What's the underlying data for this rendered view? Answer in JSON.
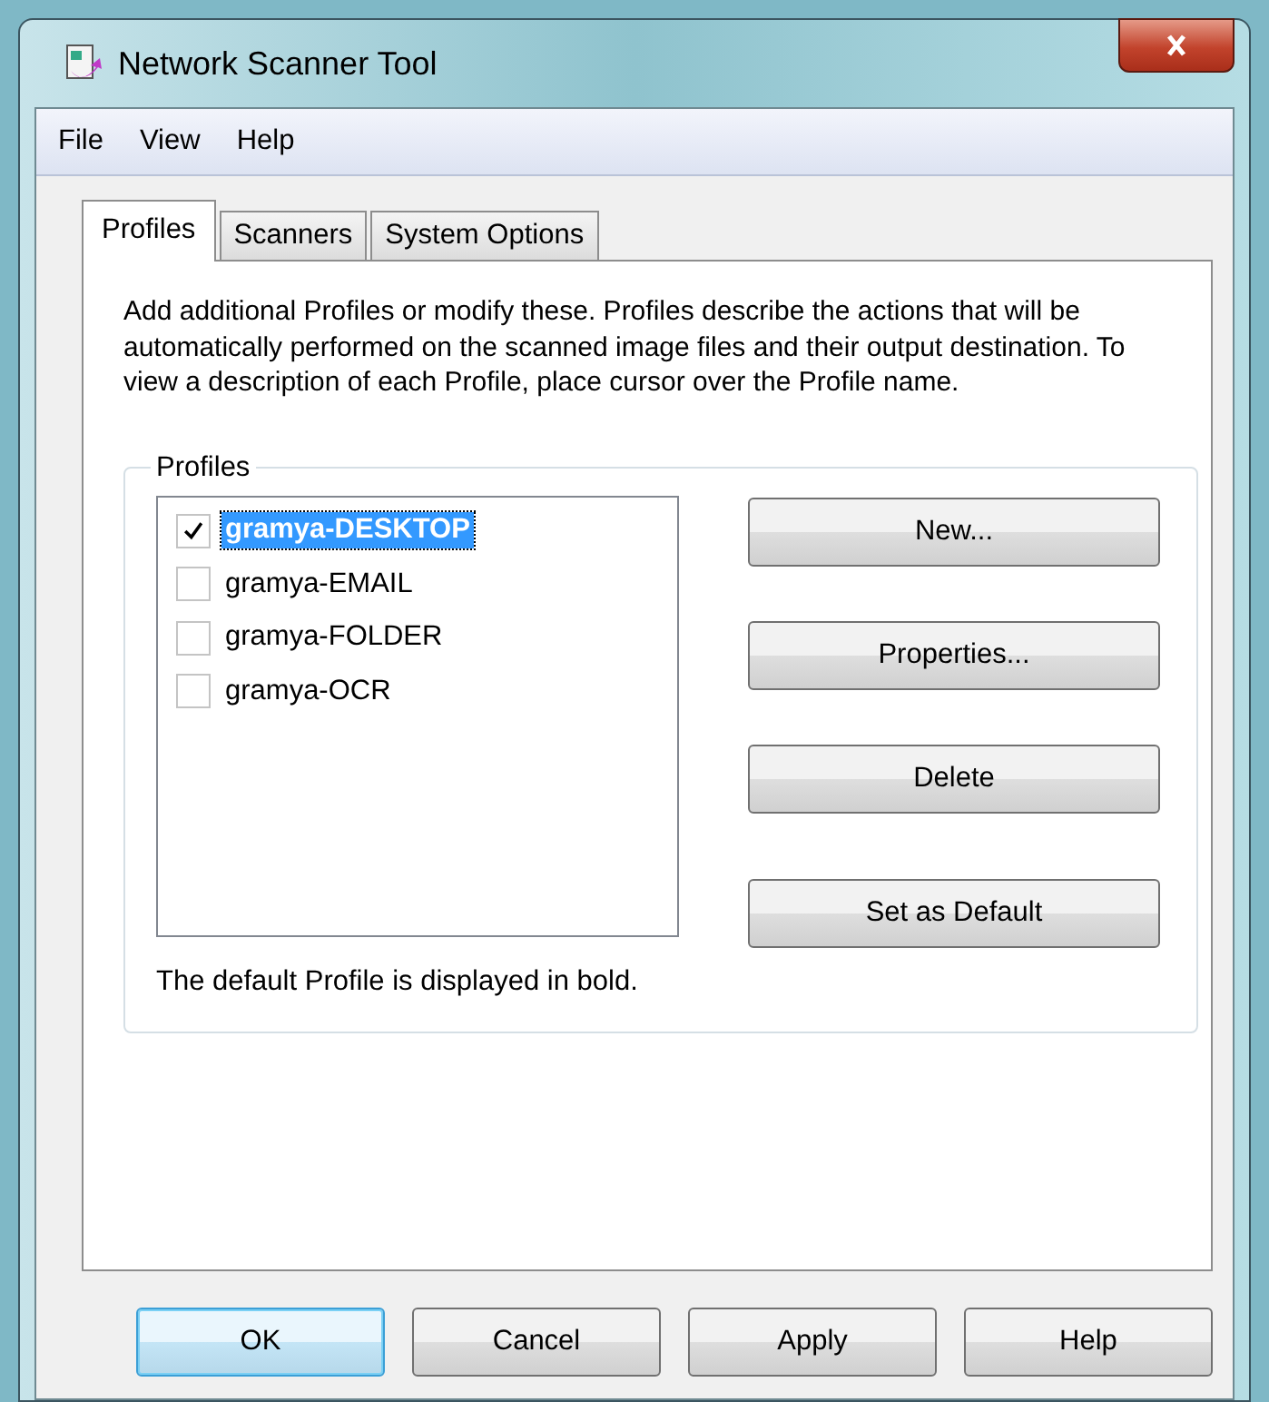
{
  "window": {
    "title": "Network Scanner Tool"
  },
  "menu": [
    {
      "label": "File"
    },
    {
      "label": "View"
    },
    {
      "label": "Help"
    }
  ],
  "tabs": [
    {
      "label": "Profiles",
      "selected": true
    },
    {
      "label": "Scanners",
      "selected": false
    },
    {
      "label": "System Options",
      "selected": false
    }
  ],
  "description": "Add additional Profiles or modify these. Profiles describe the actions that will be automatically performed on the scanned image files and their output destination. To view a description of each  Profile, place cursor over the Profile name.",
  "profiles_group": {
    "title": "Profiles",
    "items": [
      {
        "name": "gramya-DESKTOP",
        "checked": true,
        "selected": true,
        "default": true
      },
      {
        "name": "gramya-EMAIL",
        "checked": false,
        "selected": false,
        "default": false
      },
      {
        "name": "gramya-FOLDER",
        "checked": false,
        "selected": false,
        "default": false
      },
      {
        "name": "gramya-OCR",
        "checked": false,
        "selected": false,
        "default": false
      }
    ],
    "buttons": [
      {
        "label": "New..."
      },
      {
        "label": "Properties..."
      },
      {
        "label": "Delete"
      },
      {
        "label": "Set as Default"
      }
    ],
    "note": "The default Profile is displayed in bold."
  },
  "buttons": [
    {
      "label": "OK",
      "default": true
    },
    {
      "label": "Cancel",
      "default": false
    },
    {
      "label": "Apply",
      "default": false
    },
    {
      "label": "Help",
      "default": false
    }
  ]
}
